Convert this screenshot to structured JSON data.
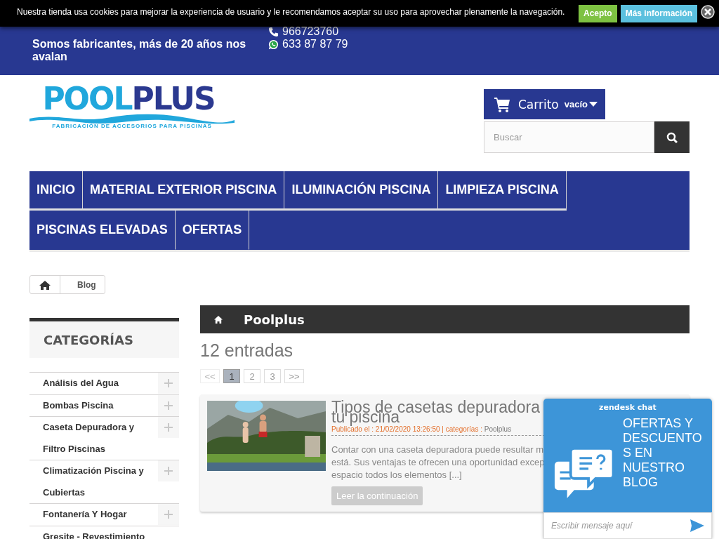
{
  "cookie_bar": {
    "message": "Nuestra tienda usa cookies para mejorar la experiencia de usuario y le recomendamos aceptar su uso para aprovechar plenamente la navegación.",
    "buttons": [
      {
        "label": "Acepto",
        "kind": "accept"
      },
      {
        "label": "Más información",
        "kind": "info"
      }
    ]
  },
  "top_bar": {
    "tagline": "Somos fabricantes, más de 20 años nos avalan",
    "phones": [
      {
        "kind": "phone",
        "number": "966723760"
      },
      {
        "kind": "whatsapp",
        "number": "633 87 87 79"
      }
    ]
  },
  "header": {
    "logo": {
      "name_parts": [
        "POOL",
        "PLUS"
      ],
      "tagline": "FABRICACIÓN DE ACCESORIOS PARA PISCINAS"
    },
    "cart": {
      "label": "Carrito",
      "status": "vacío"
    },
    "search": {
      "placeholder": "Buscar"
    }
  },
  "nav": {
    "items": [
      {
        "label": "INICIO"
      },
      {
        "label": "MATERIAL EXTERIOR PISCINA"
      },
      {
        "label": "ILUMINACIÓN PISCINA"
      },
      {
        "label": "LIMPIEZA PISCINA"
      },
      {
        "label": "PISCINAS ELEVADAS"
      },
      {
        "label": "OFERTAS"
      }
    ]
  },
  "breadcrumb": [
    {
      "label": "Blog"
    }
  ],
  "sidebar": {
    "title": "CATEGORÍAS",
    "items": [
      {
        "label": "Análisis del Agua",
        "expandable": true
      },
      {
        "label": "Bombas Piscina",
        "expandable": true
      },
      {
        "label": "Caseta Depuradora y Filtro Piscinas",
        "expandable": true
      },
      {
        "label": "Climatización Piscina y Cubiertas",
        "expandable": true
      },
      {
        "label": "Fontanería Y Hogar",
        "expandable": true
      },
      {
        "label": "Gresite - Revestimiento",
        "expandable": false
      }
    ]
  },
  "blog": {
    "category_title": "Poolplus",
    "count": "12 entradas",
    "pagination": [
      {
        "label": "<<",
        "kind": "prev",
        "selected": false,
        "disabled": true
      },
      {
        "label": "1",
        "kind": "page",
        "selected": true,
        "disabled": false
      },
      {
        "label": "2",
        "kind": "page",
        "selected": false,
        "disabled": false
      },
      {
        "label": "3",
        "kind": "page",
        "selected": false,
        "disabled": false
      },
      {
        "label": ">>",
        "kind": "next",
        "selected": false,
        "disabled": false
      }
    ],
    "posts": [
      {
        "title_lines": [
          "Tipos de casetas depuradora",
          "tu piscina"
        ],
        "published_label": "Publicado el : 21/02/2020 13:26:50 | categorías :",
        "category": "Poolplus",
        "excerpt_lines": [
          "Contar con una caseta depuradora puede resultar m",
          "está. Sus ventajas te ofrecen una oportunidad excep",
          "espacio todos los elementos [...]"
        ],
        "button": "Leer la continuación",
        "picture": {
          "kind": "picture"
        }
      }
    ]
  },
  "chat": {
    "brand": "zendesk chat",
    "message": "OFERTAS Y DESCUENTOS EN NUESTRO BLOG",
    "placeholder": "Escribir mensaje aquí"
  }
}
